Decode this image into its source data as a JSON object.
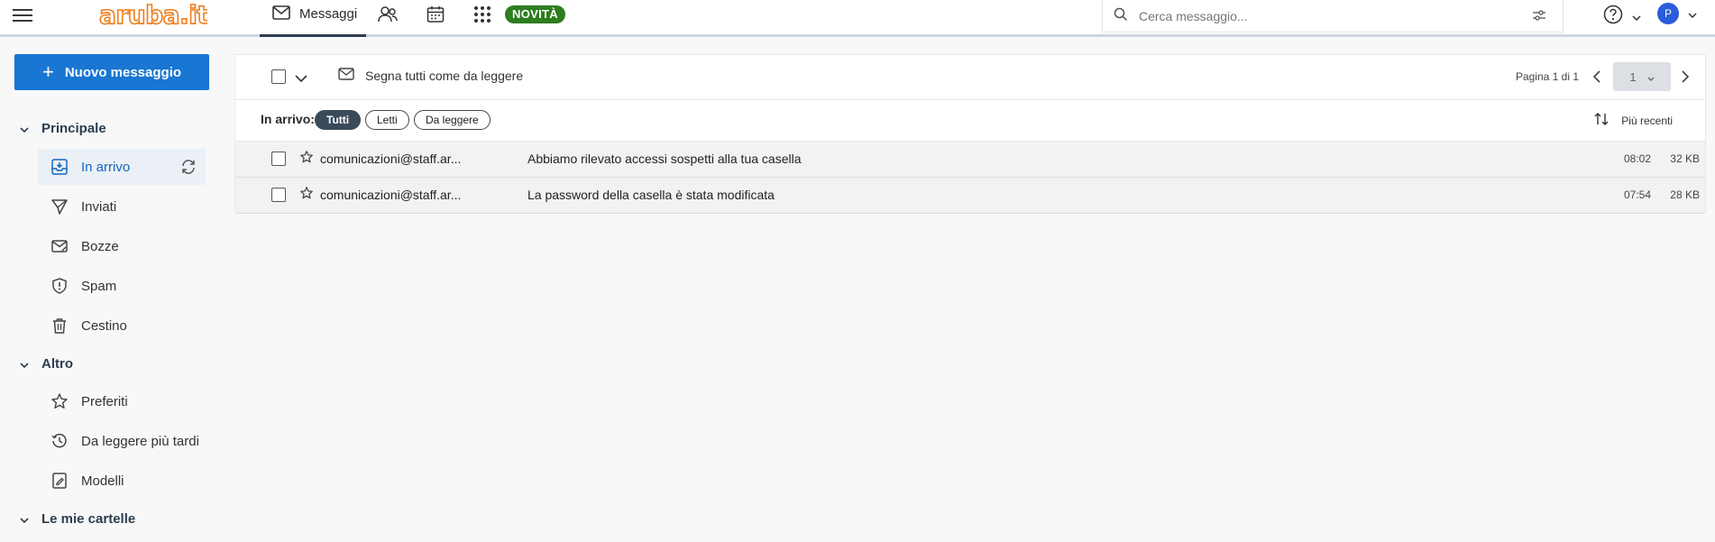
{
  "app": {
    "logo_text": "aruba.it",
    "brand_color": "#f07c1a"
  },
  "nav": {
    "messages_label": "Messaggi",
    "novita_label": "NOVITÀ"
  },
  "search": {
    "placeholder": "Cerca messaggio..."
  },
  "user": {
    "avatar_initial": "P"
  },
  "sidebar": {
    "new_message_label": "Nuovo messaggio",
    "sections": [
      {
        "label": "Principale"
      },
      {
        "label": "Altro"
      },
      {
        "label": "Le mie cartelle"
      }
    ],
    "items": [
      {
        "label": "In arrivo",
        "icon": "inbox-icon",
        "active": true
      },
      {
        "label": "Inviati",
        "icon": "send-icon"
      },
      {
        "label": "Bozze",
        "icon": "draft-icon"
      },
      {
        "label": "Spam",
        "icon": "shield-icon"
      },
      {
        "label": "Cestino",
        "icon": "trash-icon"
      },
      {
        "label": "Preferiti",
        "icon": "star-icon"
      },
      {
        "label": "Da leggere più tardi",
        "icon": "clock-icon"
      },
      {
        "label": "Modelli",
        "icon": "template-icon"
      }
    ]
  },
  "toolbar": {
    "mark_all_read_label": "Segna tutti come da leggere",
    "page_info": "Pagina 1 di 1",
    "page_select_value": "1"
  },
  "filters": {
    "label": "In arrivo:",
    "chips": [
      "Tutti",
      "Letti",
      "Da leggere"
    ],
    "active_chip": "Tutti",
    "sort_label": "Più recenti"
  },
  "messages": [
    {
      "from": "comunicazioni@staff.ar...",
      "subject": "Abbiamo rilevato accessi sospetti alla tua casella",
      "time": "08:02",
      "size": "32 KB"
    },
    {
      "from": "comunicazioni@staff.ar...",
      "subject": "La password della casella è stata modificata",
      "time": "07:54",
      "size": "28 KB"
    }
  ]
}
